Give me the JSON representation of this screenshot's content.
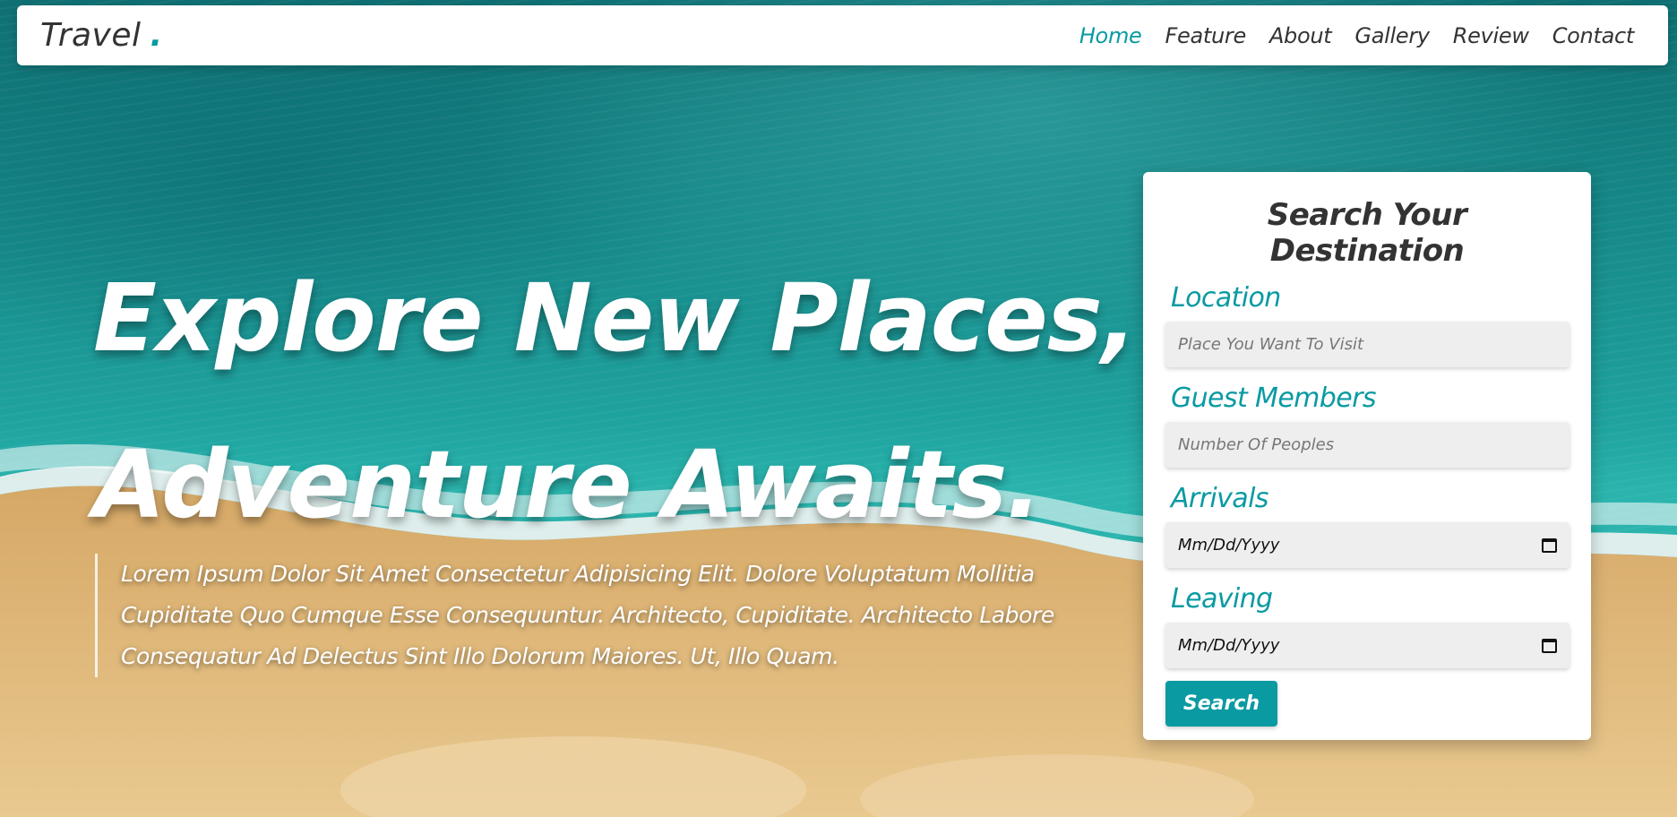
{
  "brand": {
    "name": "Travel",
    "dot": ".",
    "accent": "#0a9aa2"
  },
  "nav": {
    "items": [
      {
        "label": "Home",
        "active": true
      },
      {
        "label": "Feature"
      },
      {
        "label": "About"
      },
      {
        "label": "Gallery"
      },
      {
        "label": "Review"
      },
      {
        "label": "Contact"
      }
    ]
  },
  "hero": {
    "line1": "Explore New Places,",
    "line2": "Adventure Awaits.",
    "description": "Lorem Ipsum Dolor Sit Amet Consectetur Adipisicing Elit. Dolore Voluptatum Mollitia Cupiditate Quo Cumque Esse Consequuntur. Architecto, Cupiditate. Architecto Labore Consequatur Ad Delectus Sint Illo Dolorum Maiores. Ut, Illo Quam."
  },
  "search": {
    "title": "Search Your Destination",
    "location": {
      "label": "Location",
      "placeholder": "Place You Want To Visit"
    },
    "guests": {
      "label": "Guest Members",
      "placeholder": "Number Of Peoples"
    },
    "arrivals": {
      "label": "Arrivals",
      "value": "Mm/Dd/Yyyy"
    },
    "leaving": {
      "label": "Leaving",
      "value": "Mm/Dd/Yyyy"
    },
    "button_label": "Search"
  }
}
